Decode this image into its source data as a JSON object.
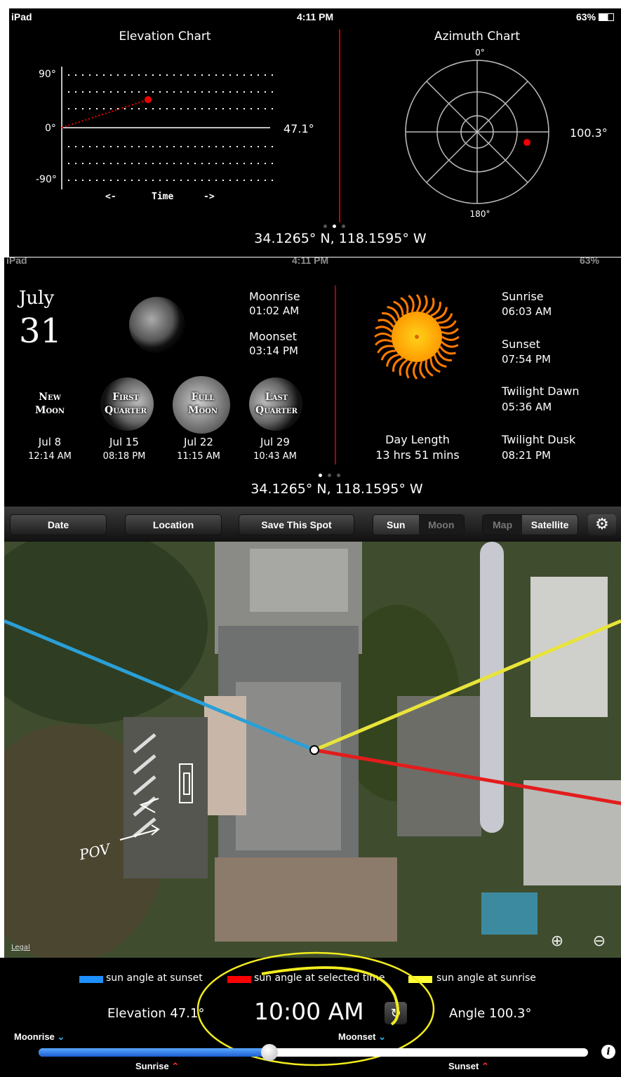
{
  "top_panel": {
    "status_bar": {
      "device": "iPad",
      "time": "4:11 PM",
      "battery": "63%"
    },
    "elevation_chart": {
      "title": "Elevation Chart",
      "y_labels": [
        "90°",
        "0°",
        "-90°"
      ],
      "time_label": "Time",
      "arrow_left": "<-",
      "arrow_right": "->",
      "current_value": "47.1°"
    },
    "azimuth_chart": {
      "title": "Azimuth Chart",
      "north_label": "0°",
      "south_label": "180°",
      "current_value": "100.3°"
    },
    "coordinates": "34.1265° N, 118.1595° W"
  },
  "middle_panel": {
    "status_bar": {
      "device": "iPad",
      "time": "4:11 PM",
      "battery": "63%"
    },
    "date": {
      "month": "July",
      "day": "31"
    },
    "moon": {
      "moonrise_label": "Moonrise",
      "moonrise_time": "01:02 AM",
      "moonset_label": "Moonset",
      "moonset_time": "03:14 PM",
      "phases": [
        {
          "name_line1": "New",
          "name_line2": "Moon",
          "date": "Jul 8",
          "time": "12:14 AM"
        },
        {
          "name_line1": "First",
          "name_line2": "Quarter",
          "date": "Jul 15",
          "time": "08:18 PM"
        },
        {
          "name_line1": "Full",
          "name_line2": "Moon",
          "date": "Jul 22",
          "time": "11:15 AM"
        },
        {
          "name_line1": "Last",
          "name_line2": "Quarter",
          "date": "Jul 29",
          "time": "10:43 AM"
        }
      ]
    },
    "sun": {
      "sunrise_label": "Sunrise",
      "sunrise_time": "06:03 AM",
      "sunset_label": "Sunset",
      "sunset_time": "07:54 PM",
      "twilight_dawn_label": "Twilight Dawn",
      "twilight_dawn_time": "05:36 AM",
      "twilight_dusk_label": "Twilight Dusk",
      "twilight_dusk_time": "08:21 PM",
      "day_length_label": "Day Length",
      "day_length_value": "13 hrs 51 mins"
    },
    "coordinates": "34.1265° N, 118.1595° W"
  },
  "toolbar": {
    "date_button": "Date",
    "location_button": "Location",
    "save_button": "Save This Spot",
    "body_segment": {
      "options": [
        "Sun",
        "Moon"
      ],
      "selected": "Sun"
    },
    "map_segment": {
      "options": [
        "Map",
        "Satellite"
      ],
      "selected": "Satellite"
    },
    "settings_icon": "gear-icon"
  },
  "map": {
    "legal_link": "Legal",
    "annotation_text": "POV",
    "zoom_in_icon": "zoom-in-icon",
    "zoom_out_icon": "zoom-out-icon"
  },
  "legend": [
    {
      "label": "sun angle at sunset",
      "color": "#1e90ff"
    },
    {
      "label": "sun angle at selected time",
      "color": "#ff0000"
    },
    {
      "label": "sun angle at sunrise",
      "color": "#ffff33"
    }
  ],
  "readout": {
    "elevation_label": "Elevation",
    "elevation_value": "47.1°",
    "selected_time": "10:00 AM",
    "angle_label": "Angle",
    "angle_value": "100.3°"
  },
  "timeline": {
    "moonrise_label": "Moonrise",
    "moonset_label": "Moonset",
    "sunrise_label": "Sunrise",
    "sunset_label": "Sunset",
    "slider_position": 0.42
  }
}
